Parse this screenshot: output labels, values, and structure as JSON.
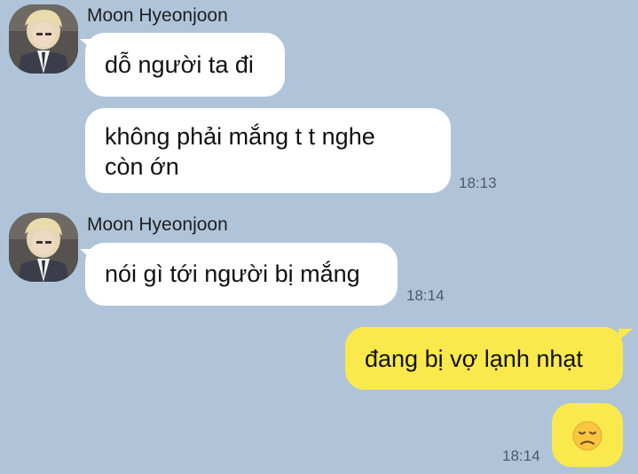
{
  "colors": {
    "background": "#b0c4d9",
    "incoming_bubble": "#ffffff",
    "outgoing_bubble": "#f9e94c",
    "timestamp": "#4e5a66"
  },
  "messages": [
    {
      "sender": "Moon Hyeonjoon",
      "direction": "incoming",
      "lines": [
        "dỗ người ta đi"
      ]
    },
    {
      "direction": "incoming",
      "lines": [
        "không phải mắng t t nghe",
        "còn ớn"
      ],
      "time": "18:13"
    },
    {
      "sender": "Moon Hyeonjoon",
      "direction": "incoming",
      "lines": [
        "nói gì tới người bị mắng"
      ],
      "time": "18:14"
    },
    {
      "direction": "outgoing",
      "lines": [
        "đang bị vợ lạnh nhạt"
      ]
    },
    {
      "direction": "outgoing",
      "emoji": "disappointed-face",
      "time": "18:14"
    }
  ]
}
